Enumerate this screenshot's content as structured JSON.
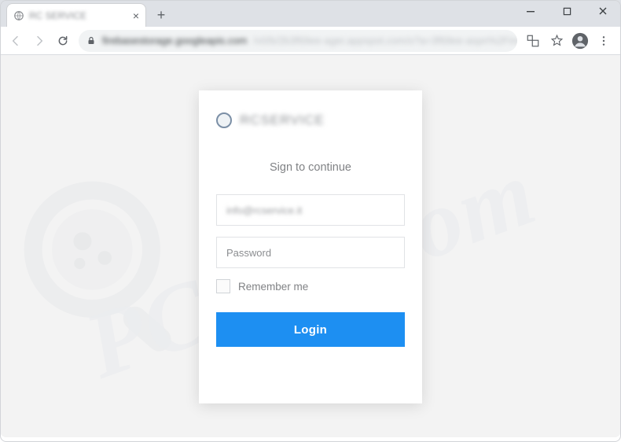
{
  "tab": {
    "title": "RC SERVICE"
  },
  "url": {
    "host": "firebasestorage.googleapis.com",
    "path": "/v0/b/2b3f69ee-ager.appspot.com/o?a=3f69ee-aspn%2Findex2ac3f69ee-aspn"
  },
  "brand": {
    "title": "RCSERVICE"
  },
  "form": {
    "heading": "Sign to continue",
    "email_value": "info@rcservice.it",
    "password_placeholder": "Password",
    "remember_label": "Remember me",
    "login_label": "Login"
  },
  "watermark": {
    "text": "PCrisk.com"
  },
  "colors": {
    "accent": "#1d8ff2"
  }
}
